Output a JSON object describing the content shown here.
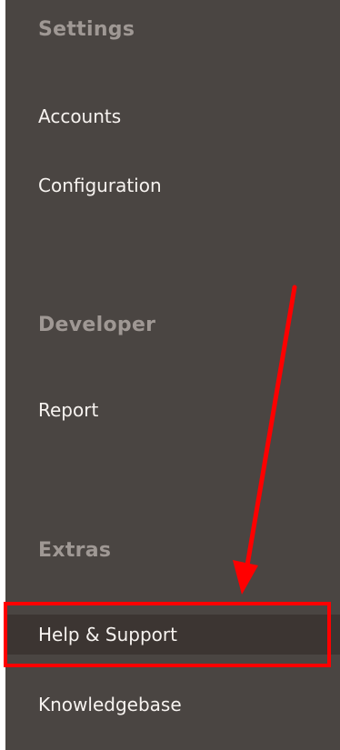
{
  "sections": [
    {
      "title": "Settings",
      "items": [
        {
          "label": "Accounts"
        },
        {
          "label": "Configuration"
        }
      ]
    },
    {
      "title": "Developer",
      "items": [
        {
          "label": "Report"
        }
      ]
    },
    {
      "title": "Extras",
      "items": [
        {
          "label": "Help & Support",
          "active": true
        },
        {
          "label": "Knowledgebase"
        }
      ]
    }
  ],
  "annotation": {
    "color": "#ff0000",
    "highlighted_item": "Help & Support"
  }
}
